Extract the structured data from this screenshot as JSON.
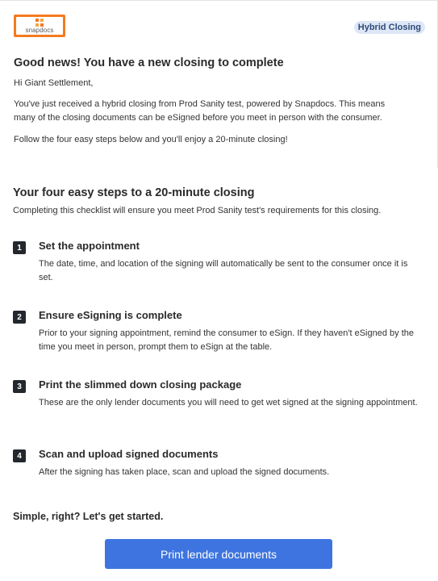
{
  "header": {
    "logo_text": "snapdocs",
    "badge": "Hybrid Closing",
    "colors": {
      "logo": "#f47b20",
      "badge_bg": "#dde7f6",
      "button": "#3d74df"
    }
  },
  "intro": {
    "title": "Good news! You have a new closing to complete",
    "greeting": "Hi Giant Settlement,",
    "body": "You've just received a hybrid closing from Prod Sanity test, powered by Snapdocs. This means many of the closing documents can be eSigned before you meet in person with the consumer.",
    "follow": "Follow the four easy steps below and you'll enjoy a 20-minute closing!"
  },
  "steps_section": {
    "title": "Your four easy steps to a 20-minute closing",
    "subtitle": "Completing this checklist will ensure you meet Prod Sanity test's requirements for this closing.",
    "steps": [
      {
        "number": "1",
        "title": "Set the appointment",
        "desc": "The date, time, and location of the signing will automatically be sent to the consumer once it is set."
      },
      {
        "number": "2",
        "title": "Ensure eSigning is complete",
        "desc": "Prior to your signing appointment, remind the consumer to eSign. If they haven't eSigned by the time you meet in person, prompt them to eSign at the table."
      },
      {
        "number": "3",
        "title": "Print the slimmed down closing package",
        "desc": "These are the only lender documents you will need to get wet signed at the signing appointment."
      },
      {
        "number": "4",
        "title": "Scan and upload signed documents",
        "desc": "After the signing has taken place, scan and upload the signed documents."
      }
    ]
  },
  "footer": {
    "closing": "Simple, right? Let's get started.",
    "button_label": "Print lender documents"
  }
}
